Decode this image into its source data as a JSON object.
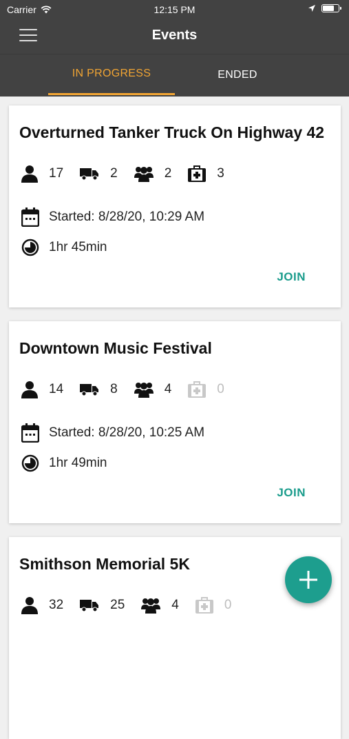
{
  "status_bar": {
    "carrier": "Carrier",
    "time": "12:15 PM",
    "battery_level": 0.75
  },
  "header": {
    "title": "Events",
    "menu_icon": "hamburger-menu-icon"
  },
  "tabs": [
    {
      "label": "IN PROGRESS",
      "active": true
    },
    {
      "label": "ENDED",
      "active": false
    }
  ],
  "colors": {
    "appbar": "#424242",
    "accent": "#f2a533",
    "teal": "#1a9c8c"
  },
  "events": [
    {
      "title": "Overturned Tanker Truck On Highway 42",
      "people": "17",
      "vehicles": "2",
      "groups": "2",
      "medical": "3",
      "started": "Started: 8/28/20, 10:29 AM",
      "duration": "1hr 45min",
      "join": "JOIN"
    },
    {
      "title": "Downtown Music Festival",
      "people": "14",
      "vehicles": "8",
      "groups": "4",
      "medical": "0",
      "started": "Started: 8/28/20, 10:25 AM",
      "duration": "1hr 49min",
      "join": "JOIN"
    },
    {
      "title": "Smithson Memorial 5K",
      "people": "32",
      "vehicles": "25",
      "groups": "4",
      "medical": "0"
    }
  ],
  "fab": {
    "icon": "plus-icon"
  }
}
